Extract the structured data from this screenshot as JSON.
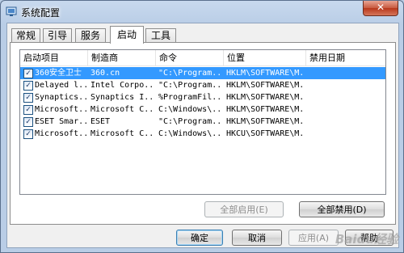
{
  "window": {
    "title": "系统配置",
    "close_label": "✕"
  },
  "tabs": [
    {
      "label": "常规"
    },
    {
      "label": "引导"
    },
    {
      "label": "服务"
    },
    {
      "label": "启动"
    },
    {
      "label": "工具"
    }
  ],
  "list": {
    "columns": [
      "启动项目",
      "制造商",
      "命令",
      "位置",
      "禁用日期"
    ],
    "rows": [
      {
        "item": "360安全卫士",
        "maker": "360.cn",
        "command": "\"C:\\Program...",
        "location": "HKLM\\SOFTWARE\\M...",
        "date": ""
      },
      {
        "item": "Delayed l...",
        "maker": "Intel Corpo...",
        "command": "\"C:\\Program...",
        "location": "HKLM\\SOFTWARE\\M...",
        "date": ""
      },
      {
        "item": "Synaptics...",
        "maker": "Synaptics I...",
        "command": "%ProgramFil...",
        "location": "HKLM\\SOFTWARE\\M...",
        "date": ""
      },
      {
        "item": "Microsoft...",
        "maker": "Microsoft C...",
        "command": "C:\\Windows\\...",
        "location": "HKLM\\SOFTWARE\\M...",
        "date": ""
      },
      {
        "item": "ESET Smar...",
        "maker": "ESET",
        "command": "\"C:\\Program...",
        "location": "HKLM\\SOFTWARE\\M...",
        "date": ""
      },
      {
        "item": "Microsoft...",
        "maker": "Microsoft C...",
        "command": "C:\\Windows\\...",
        "location": "HKCU\\SOFTWARE\\M...",
        "date": ""
      }
    ]
  },
  "panel_buttons": {
    "enable_all": "全部启用(E)",
    "disable_all": "全部禁用(D)"
  },
  "dialog_buttons": {
    "ok": "确定",
    "cancel": "取消",
    "apply": "应用(A)",
    "help": "帮助"
  },
  "watermark": "Baidu经验",
  "colors": {
    "selection": "#3399ff",
    "title_bg": "#b9cde6"
  }
}
